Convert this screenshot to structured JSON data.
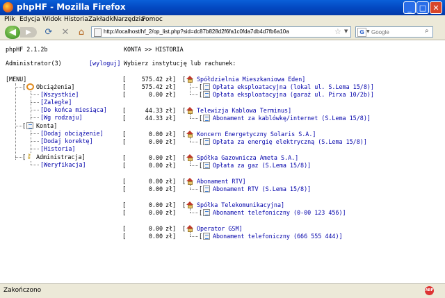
{
  "window": {
    "title": "phpHF - Mozilla Firefox"
  },
  "menu": [
    "Plik",
    "Edycja",
    "Widok",
    "Historia",
    "Zakładki",
    "Narzędzia",
    "Pomoc"
  ],
  "nav": {
    "url": "http://localhost/hf_2/op_list.php?sid=dc87b828d2f6fa1c0fda7db4d7fb6a10a",
    "search_placeholder": "Google"
  },
  "app": {
    "version": "phpHF 2.1.2b",
    "user": "Administrator(3)",
    "logout": "[wyloguj]",
    "breadcrumb": "KONTA >> HISTORIA",
    "prompt": "Wybierz instytucję lub rachunek:"
  },
  "sidebar": {
    "menu_label": "[MENU]",
    "sections": [
      {
        "label": "Obciążenia]",
        "open_bracket": "[",
        "items": [
          "[Wszystkie]",
          "[Zaległe]",
          "[Do końca miesiąca]",
          "[Wg rodzaju]"
        ]
      },
      {
        "label": "Konta]",
        "open_bracket": "[",
        "items": [
          "[Dodaj obciążenie]",
          "[Dodaj korektę]",
          "[Historia]"
        ]
      },
      {
        "label": "Administracja]",
        "open_bracket": "[",
        "items": [
          "[Weryfikacja]"
        ]
      }
    ]
  },
  "currency": "zł]",
  "institutions": [
    {
      "amount": "575.42",
      "name": "Spółdzielnia Mieszkaniowa Eden]",
      "accounts": [
        {
          "amount": "575.42",
          "name": "Opłata eksploatacyjna (lokal ul. S.Lema 15/8)]"
        },
        {
          "amount": "0.00",
          "name": "Opłata eksploatacyjna (garaż ul. Pirxa 10/2b)]"
        }
      ]
    },
    {
      "amount": "44.33",
      "name": "Telewizja Kablowa Terminus]",
      "accounts": [
        {
          "amount": "44.33",
          "name": "Abonament za kablówkę/internet (S.Lema 15/8)]"
        }
      ]
    },
    {
      "amount": "0.00",
      "name": "Koncern Energetyczny Solaris S.A.]",
      "accounts": [
        {
          "amount": "0.00",
          "name": "Opłata za energię elektryczną (S.Lema 15/8)]"
        }
      ]
    },
    {
      "amount": "0.00",
      "name": "Spółka Gazownicza Ameta S.A.]",
      "accounts": [
        {
          "amount": "0.00",
          "name": "Opłata za gaz (S.Lema 15/8)]"
        }
      ]
    },
    {
      "amount": "0.00",
      "name": "Abonament RTV]",
      "accounts": [
        {
          "amount": "0.00",
          "name": "Abonament RTV (S.Lema 15/8)]"
        }
      ]
    },
    {
      "amount": "0.00",
      "name": "Spółka Telekomunikacyjna]",
      "accounts": [
        {
          "amount": "0.00",
          "name": "Abonament telefoniczny (0-00 123 456)]"
        }
      ]
    },
    {
      "amount": "0.00",
      "name": "Operator GSM]",
      "accounts": [
        {
          "amount": "0.00",
          "name": "Abonament telefoniczny (666 555 444)]"
        }
      ]
    }
  ],
  "status": {
    "text": "Zakończono",
    "adblock": "ABP"
  }
}
